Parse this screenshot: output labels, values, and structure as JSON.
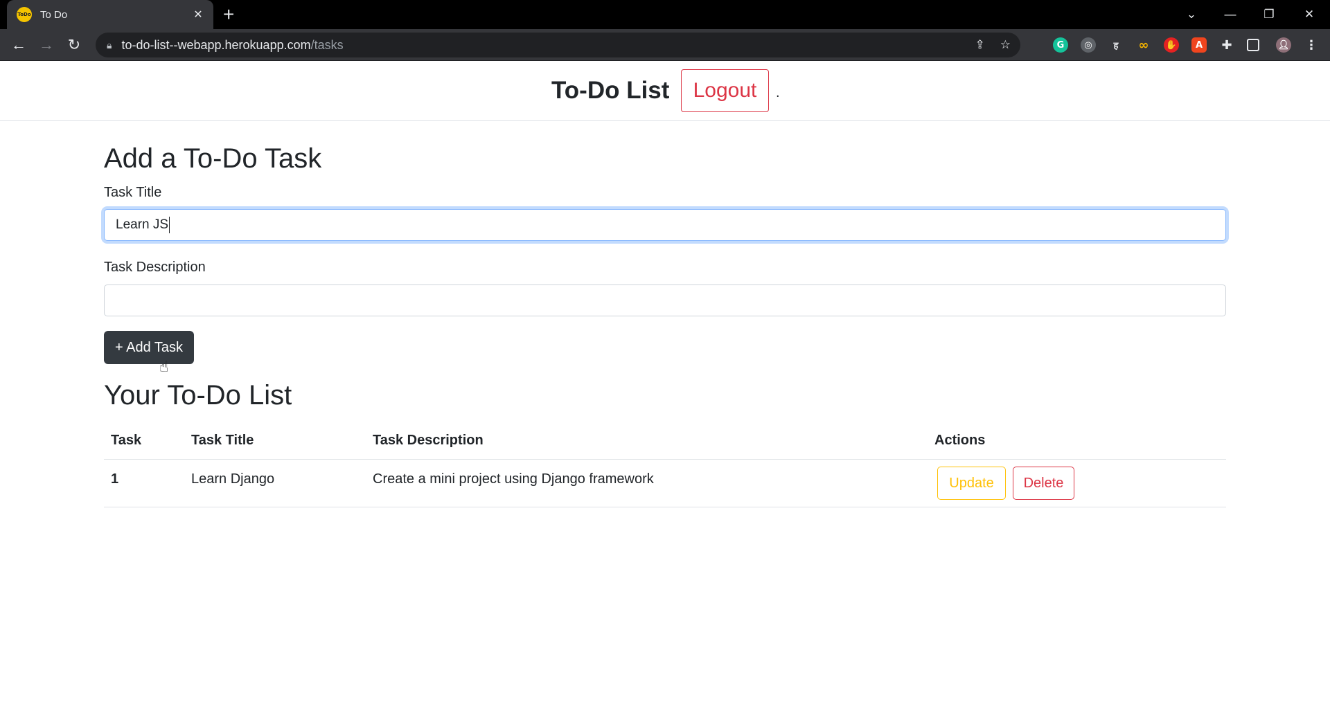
{
  "browser": {
    "tab_title": "To Do",
    "favicon_text": "ToDo",
    "url_host": "to-do-list--webapp.herokuapp.com",
    "url_path": "/tasks"
  },
  "header": {
    "brand": "To-Do List",
    "logout_label": "Logout",
    "dot": "."
  },
  "form": {
    "heading": "Add a To-Do Task",
    "title_label": "Task Title",
    "title_value": "Learn JS",
    "description_label": "Task Description",
    "description_value": "",
    "add_button_label": "+ Add Task"
  },
  "list": {
    "heading": "Your To-Do List",
    "columns": [
      "Task",
      "Task Title",
      "Task Description",
      "Actions"
    ],
    "rows": [
      {
        "number": "1",
        "title": "Learn Django",
        "description": "Create a mini project using Django framework",
        "update_label": "Update",
        "delete_label": "Delete"
      }
    ]
  },
  "colors": {
    "danger": "#dc3545",
    "warning": "#ffc107",
    "dark_button": "#343a40",
    "focus_border": "#86b7fe"
  }
}
